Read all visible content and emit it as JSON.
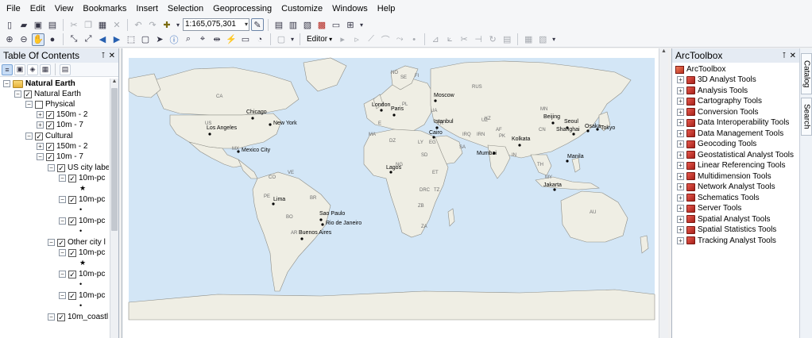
{
  "menu": [
    "File",
    "Edit",
    "View",
    "Bookmarks",
    "Insert",
    "Selection",
    "Geoprocessing",
    "Customize",
    "Windows",
    "Help"
  ],
  "toolbar": {
    "scale_value": "1:165,075,301",
    "editor_label": "Editor"
  },
  "toc": {
    "title": "Table Of Contents",
    "rows": [
      {
        "label": "Natural Earth",
        "bold": true
      },
      {
        "label": "Natural Earth"
      },
      {
        "label": "Physical"
      },
      {
        "label": "150m - 2"
      },
      {
        "label": "10m - 7"
      },
      {
        "label": "Cultural"
      },
      {
        "label": "150m - 2"
      },
      {
        "label": "10m - 7"
      },
      {
        "label": "US city labe"
      },
      {
        "label": "10m-pc"
      },
      {
        "label": "10m-pc"
      },
      {
        "label": "10m-pc"
      },
      {
        "label": "Other city l"
      },
      {
        "label": "10m-pc"
      },
      {
        "label": "10m-pc"
      },
      {
        "label": "10m-pc"
      },
      {
        "label": "10m_coastl"
      }
    ]
  },
  "toolbox": {
    "title": "ArcToolbox",
    "root": "ArcToolbox",
    "items": [
      "3D Analyst Tools",
      "Analysis Tools",
      "Cartography Tools",
      "Conversion Tools",
      "Data Interoperability Tools",
      "Data Management Tools",
      "Geocoding Tools",
      "Geostatistical Analyst Tools",
      "Linear Referencing Tools",
      "Multidimension Tools",
      "Network Analyst Tools",
      "Schematics Tools",
      "Server Tools",
      "Spatial Analyst Tools",
      "Spatial Statistics Tools",
      "Tracking Analyst Tools"
    ]
  },
  "side_tabs": [
    "Catalog",
    "Search"
  ],
  "map": {
    "ocean_color": "#d3e6f6",
    "land_color": "#efeee4",
    "cities": [
      "London",
      "Paris",
      "Moscow",
      "Istanbul",
      "Cairo",
      "Lagos",
      "Mumbai",
      "Kolkata",
      "Beijing",
      "Seoul",
      "Shanghai",
      "Osaka",
      "Tokyo",
      "Manila",
      "Jakarta",
      "Chicago",
      "New York",
      "Los Angeles",
      "Mexico City",
      "Lima",
      "Sao Paulo",
      "Rio de Janeiro",
      "Buenos Aires"
    ],
    "country_codes": [
      "CA",
      "US",
      "MX",
      "RUS",
      "KZ",
      "CN",
      "IN",
      "UZ",
      "MN",
      "AF",
      "PK",
      "IRN",
      "IRQ",
      "SA",
      "TR",
      "DZ",
      "LY",
      "EG",
      "NG",
      "ET",
      "SD",
      "DRC",
      "TZ",
      "ZA",
      "BR",
      "AR",
      "PE",
      "CO",
      "VE",
      "MA",
      "TH",
      "MY",
      "FI",
      "SE",
      "UA",
      "PL",
      "E",
      "NO",
      "AU",
      "ZB",
      "BO"
    ]
  }
}
